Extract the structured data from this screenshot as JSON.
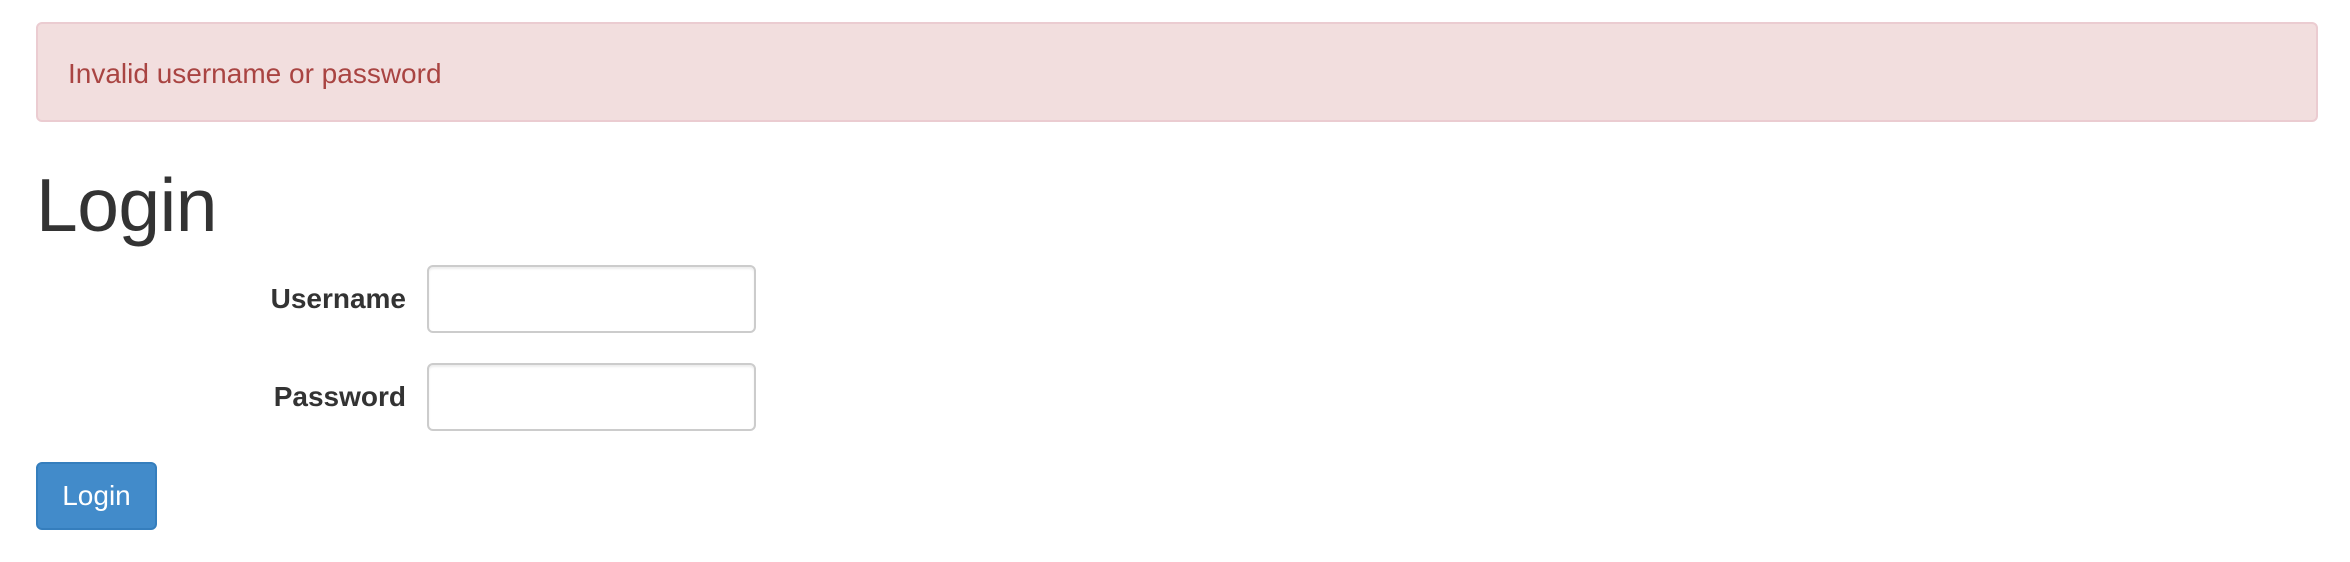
{
  "alert": {
    "message": "Invalid username or password",
    "colors": {
      "background": "#f2dede",
      "border": "#ebccd1",
      "text": "#a94442"
    }
  },
  "page": {
    "title": "Login"
  },
  "form": {
    "username": {
      "label": "Username",
      "value": "",
      "placeholder": ""
    },
    "password": {
      "label": "Password",
      "value": "",
      "placeholder": ""
    },
    "submit_label": "Login",
    "submit_color": "#428bca"
  }
}
